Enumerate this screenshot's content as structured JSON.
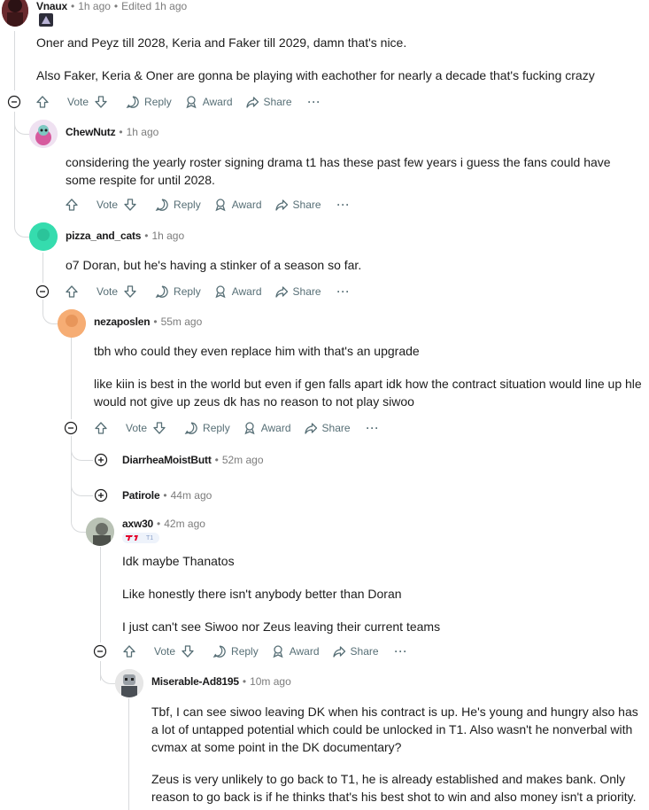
{
  "comments": {
    "vnaux": {
      "username": "Vnaux",
      "time": "1h ago",
      "edited": "Edited 1h ago",
      "lines": [
        "Oner and Peyz till 2028, Keria and Faker till 2029, damn that's nice.",
        "Also Faker, Keria & Oner are gonna be playing with eachother for nearly a decade that's fucking crazy"
      ]
    },
    "chewnutz": {
      "username": "ChewNutz",
      "time": "1h ago",
      "lines": [
        "considering the yearly roster signing drama t1 has these past few years i guess the fans could have some respite for until 2028."
      ]
    },
    "pizza": {
      "username": "pizza_and_cats",
      "time": "1h ago",
      "lines": [
        "o7 Doran, but he's having a stinker of a season so far."
      ]
    },
    "nezaposlen": {
      "username": "nezaposlen",
      "time": "55m ago",
      "lines": [
        "tbh who could they even replace him with that's an upgrade",
        "like kiin is best in the world but even if gen falls apart idk how the contract situation would line up hle would not give up zeus dk has no reason to not play siwoo"
      ]
    },
    "diarrhea": {
      "username": "DiarrheaMoistButt",
      "time": "52m ago"
    },
    "patirole": {
      "username": "Patirole",
      "time": "44m ago"
    },
    "axw30": {
      "username": "axw30",
      "time": "42m ago",
      "flair": "T1",
      "lines": [
        "Idk maybe Thanatos",
        "Like honestly there isn't anybody better than Doran",
        "I just can't see Siwoo nor Zeus leaving their current teams"
      ]
    },
    "miserable": {
      "username": "Miserable-Ad8195",
      "time": "10m ago",
      "lines": [
        "Tbf, I can see siwoo leaving DK when his contract is up. He's young and hungry also has a lot of untapped potential which could be unlocked in T1. Also wasn't he nonverbal with cvmax at some point in the DK documentary?",
        "Zeus is very unlikely to go back to T1, he is already established and makes bank. Only reason to go back is if he thinks that's his best shot to win and also money isn't a priority."
      ]
    }
  },
  "actions": {
    "vote": "Vote",
    "reply": "Reply",
    "award": "Award",
    "share": "Share",
    "more": "···"
  },
  "colors": {
    "text": "#1a1a1b",
    "muted": "#576f76",
    "line": "#d8dadc",
    "flair_red": "#e4002b"
  }
}
